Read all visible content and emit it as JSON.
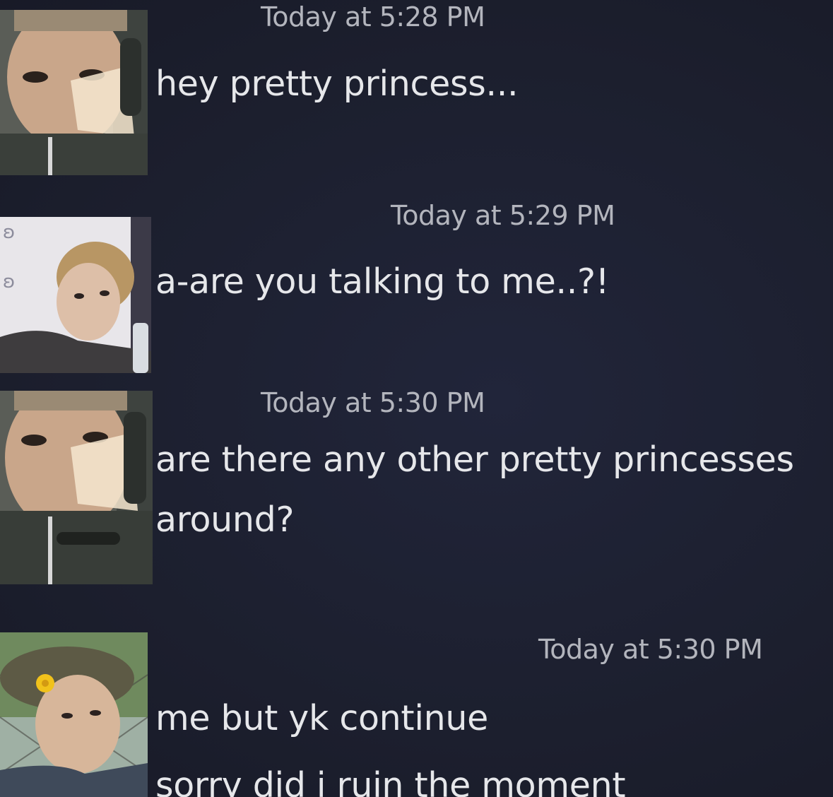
{
  "messages": [
    {
      "avatar_icon": "avatar-photo-helmet-headset",
      "timestamp": "Today at 5:28 PM",
      "lines": [
        "hey pretty princess..."
      ]
    },
    {
      "avatar_icon": "avatar-photo-blond-jacket",
      "timestamp": "Today at 5:29 PM",
      "lines": [
        "a-are you talking to me..?!"
      ]
    },
    {
      "avatar_icon": "avatar-photo-helmet-headset",
      "timestamp": "Today at 5:30 PM",
      "lines": [
        "are there any other pretty princesses",
        "around?"
      ]
    },
    {
      "avatar_icon": "avatar-photo-cap-flower",
      "timestamp": "Today at 5:30 PM",
      "lines": [
        "me but yk continue",
        "sorry did i ruin the moment"
      ]
    }
  ]
}
